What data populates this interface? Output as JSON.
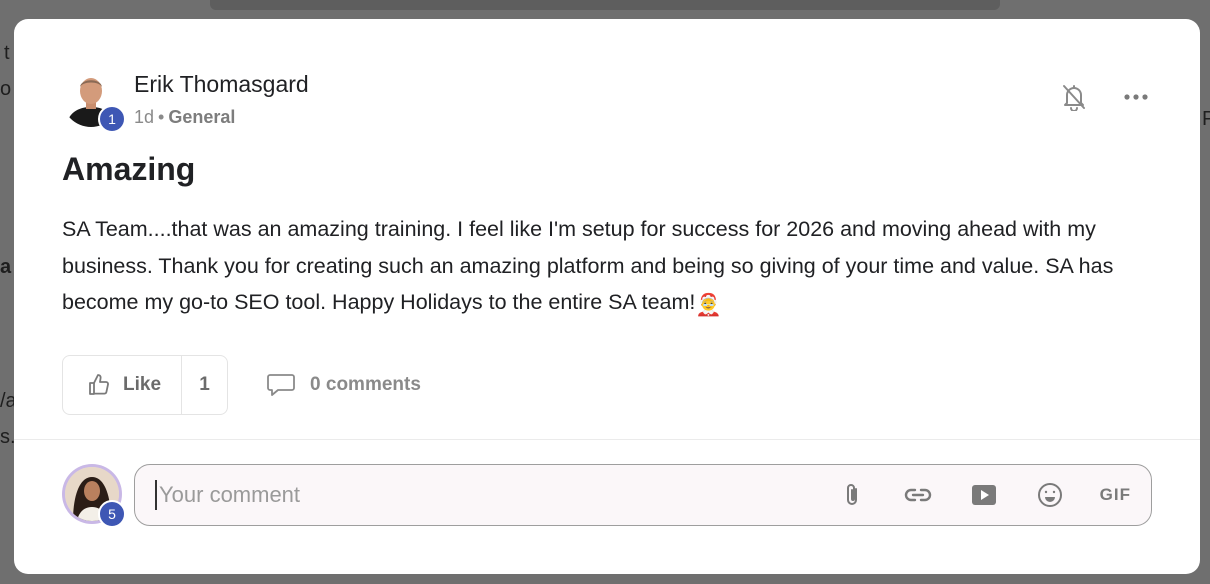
{
  "background": {
    "fragments": [
      "t",
      "o",
      "a",
      "/a",
      "s.",
      "P"
    ]
  },
  "post": {
    "author": {
      "name": "Erik Thomasgard",
      "level": "1",
      "avatar_icon": "author-avatar"
    },
    "meta": {
      "time": "1d",
      "separator": "•",
      "category": "General"
    },
    "header_actions": {
      "notify_icon": "bell-off-icon",
      "more_icon": "more-horizontal-icon"
    },
    "title": "Amazing",
    "body": "SA Team....that was an amazing training. I feel like I'm setup for success for 2026 and moving ahead with my business. Thank you for creating such an amazing platform and being so giving of your time and value. SA has become my go-to SEO tool. Happy Holidays to the entire SA team!",
    "body_emoji": "🤶",
    "like": {
      "label": "Like",
      "count": "1"
    },
    "comments": {
      "label": "0 comments"
    }
  },
  "comment_composer": {
    "user_level": "5",
    "placeholder": "Your comment",
    "tools": {
      "attach_icon": "paperclip-icon",
      "link_icon": "link-icon",
      "video_icon": "video-icon",
      "emoji_icon": "emoji-icon",
      "gif_label": "GIF"
    }
  },
  "colors": {
    "badge": "#3e57b4",
    "overlay": "#6f6f6f",
    "modal": "#ffffff",
    "muted_text": "#8a8a8a"
  }
}
